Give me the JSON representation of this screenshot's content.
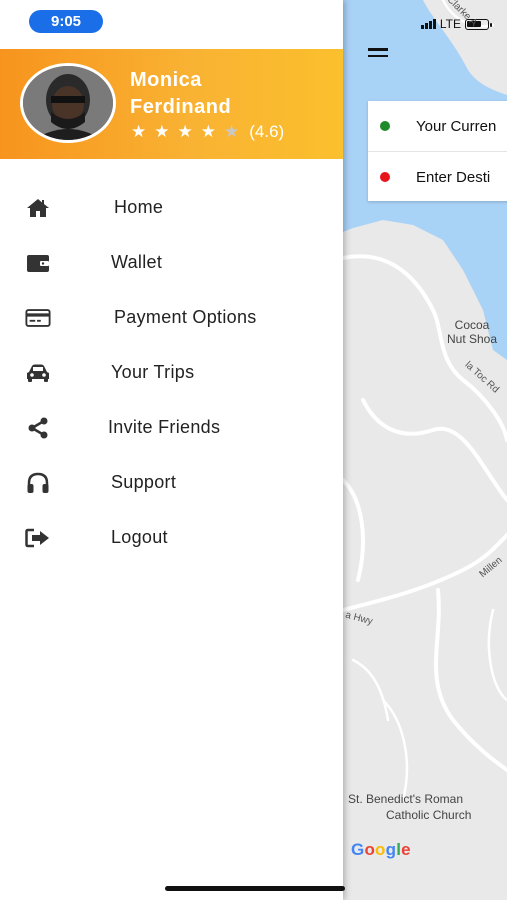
{
  "status": {
    "time": "9:05",
    "network": "LTE"
  },
  "profile": {
    "name_first": "Monica",
    "name_last": "Ferdinand",
    "stars_filled": 4,
    "stars_total": 5,
    "rating_text": "(4.6)"
  },
  "menu": {
    "items": [
      {
        "label": "Home",
        "icon": "home-icon"
      },
      {
        "label": "Wallet",
        "icon": "wallet-icon"
      },
      {
        "label": "Payment Options",
        "icon": "credit-card-icon"
      },
      {
        "label": "Your Trips",
        "icon": "car-icon"
      },
      {
        "label": "Invite Friends",
        "icon": "share-icon"
      },
      {
        "label": "Support",
        "icon": "headphones-icon"
      },
      {
        "label": "Logout",
        "icon": "logout-icon"
      }
    ]
  },
  "map": {
    "current_location_label": "Your Curren",
    "destination_label": "Enter Desti",
    "place_cocoa": "Cocoa\nNut Shoa",
    "road_toc": "la Toc Rd",
    "road_hwy": "a Hwy",
    "road_millen": "Millen",
    "road_clarke": "Clarke A",
    "place_church_line1": "St. Benedict's Roman",
    "place_church_line2": "Catholic Church",
    "attribution": "Google",
    "colors": {
      "water": "#a9d2f7",
      "land": "#e9e9e9",
      "road": "#ffffff",
      "current_dot": "#1e8a2a",
      "dest_dot": "#e8141b"
    }
  },
  "theme": {
    "header_gradient_start": "#f7941d",
    "header_gradient_end": "#fbc02d",
    "time_pill": "#1a6ee8"
  }
}
